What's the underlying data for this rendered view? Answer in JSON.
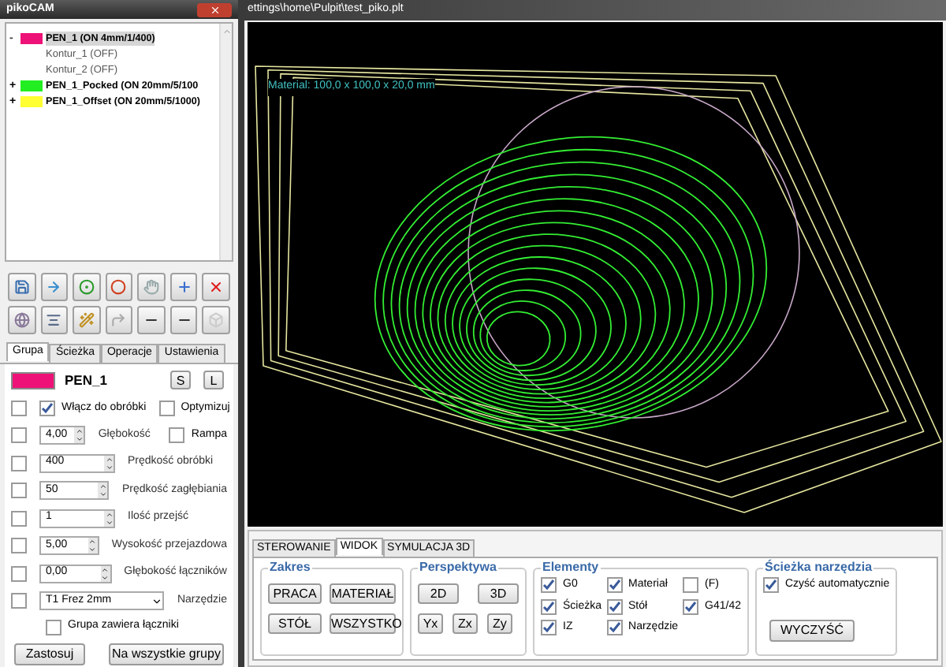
{
  "left_window": {
    "title": "pikoCAM",
    "layers": [
      {
        "label": "PEN_1 (ON 4mm/1/400)",
        "color": "#ee1177",
        "expander": "-",
        "expanded": true,
        "selected": true,
        "children": [
          {
            "label": "Kontur_1 (OFF)"
          },
          {
            "label": "Kontur_2 (OFF)"
          }
        ]
      },
      {
        "label": "PEN_1_Pocked (ON 20mm/5/100",
        "color": "#22ee22",
        "expander": "+",
        "expanded": false,
        "selected": false
      },
      {
        "label": "PEN_1_Offset (ON 20mm/5/1000)",
        "color": "#ffff33",
        "expander": "+",
        "expanded": false,
        "selected": false
      }
    ],
    "tabs": [
      {
        "label": "Grupa",
        "selected": true
      },
      {
        "label": "Ścieżka",
        "selected": false
      },
      {
        "label": "Operacje",
        "selected": false
      },
      {
        "label": "Ustawienia",
        "selected": false
      }
    ],
    "pen": {
      "name": "PEN_1",
      "color": "#ee1177",
      "buttons": [
        "S",
        "L"
      ]
    },
    "enable": {
      "row_checked": false,
      "include": {
        "label": "Włącz do obróbki",
        "checked": true
      },
      "optimize": {
        "label": "Optymizuj",
        "checked": false
      }
    },
    "params": [
      {
        "kind": "spin",
        "value": "4,00",
        "label": "Głębokość",
        "checked": false,
        "extra": {
          "label": "Rampa",
          "checked": false
        }
      },
      {
        "kind": "spin",
        "value": "400",
        "label": "Prędkość obróbki",
        "checked": false
      },
      {
        "kind": "spin",
        "value": "50",
        "label": "Prędkość zagłębiania",
        "checked": false
      },
      {
        "kind": "spin",
        "value": "1",
        "label": "Ilość przejść",
        "checked": false
      },
      {
        "kind": "spin",
        "value": "5,00",
        "label": "Wysokość przejazdowa",
        "checked": false
      },
      {
        "kind": "spin",
        "value": "0,00",
        "label": "Głębokość łączników",
        "checked": false
      },
      {
        "kind": "select",
        "value": "T1 Frez 2mm",
        "label": "Narzędzie",
        "checked": false
      }
    ],
    "bridges": {
      "label": "Grupa zawiera łączniki",
      "checked": false
    },
    "buttons": [
      "Zastosuj",
      "Na wszystkie grupy"
    ]
  },
  "right_window": {
    "title": "ettings\\home\\Pulpit\\test_piko.plt",
    "material_label": "Material: 100,0 x 100,0 x 20,0 mm",
    "tabs": [
      {
        "label": "STEROWANIE",
        "selected": false
      },
      {
        "label": "WIDOK",
        "selected": true
      },
      {
        "label": "SYMULACJA 3D",
        "selected": false
      }
    ],
    "groups": [
      {
        "kind": "buttons",
        "title": "Zakres",
        "buttons": [
          "PRACA",
          "MATERIAŁ",
          "STÓŁ",
          "WSZYSTKO"
        ]
      },
      {
        "kind": "perspective",
        "title": "Perspektywa",
        "buttons": [
          "2D",
          "3D",
          "Yx",
          "Zx",
          "Zy"
        ]
      },
      {
        "kind": "checks",
        "title": "Elementy",
        "items": [
          {
            "label": "G0",
            "checked": true
          },
          {
            "label": "Materiał",
            "checked": true
          },
          {
            "label": "(F)",
            "checked": false
          },
          {
            "label": "Ścieżka",
            "checked": true
          },
          {
            "label": "Stół",
            "checked": true
          },
          {
            "label": "G41/42",
            "checked": true
          },
          {
            "label": "IZ",
            "checked": true
          },
          {
            "label": "Narzędzie",
            "checked": true
          }
        ]
      },
      {
        "kind": "path",
        "title": "Ścieżka narzędzia",
        "check": {
          "label": "Czyść automatycznie",
          "checked": true
        },
        "button": "WYCZYŚĆ"
      }
    ]
  }
}
